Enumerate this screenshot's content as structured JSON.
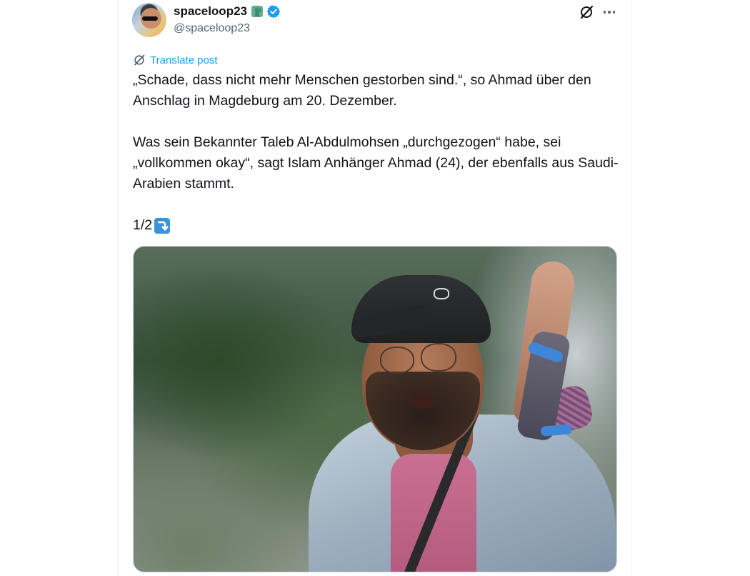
{
  "author": {
    "display_name": "spaceloop23",
    "handle": "@spaceloop23",
    "badge_icon": "statue-of-liberty-icon",
    "verified": true,
    "verified_color": "#1d9bf0"
  },
  "header_actions": {
    "grok_icon": "grok-icon",
    "more_icon": "more-icon"
  },
  "translate": {
    "label": "Translate post",
    "color": "#1d9bf0"
  },
  "post": {
    "paragraph1": "„Schade, dass nicht mehr Menschen gestorben sind.“, so Ahmad über den Anschlag in Magdeburg am 20. Dezember.",
    "paragraph2": "Was sein Bekannter Taleb Al-Abdulmohsen „durchgezogen“ habe, sei „vollkommen okay“, sagt Islam Anhänger Ahmad (24), der ebenfalls aus Saudi-Arabien stammt.",
    "counter": "1/2",
    "counter_emoji": "right-arrow-curving-down-icon"
  },
  "media": {
    "type": "video-thumbnail"
  },
  "colors": {
    "text": "#0f1419",
    "secondary_text": "#536471",
    "accent": "#1d9bf0"
  }
}
